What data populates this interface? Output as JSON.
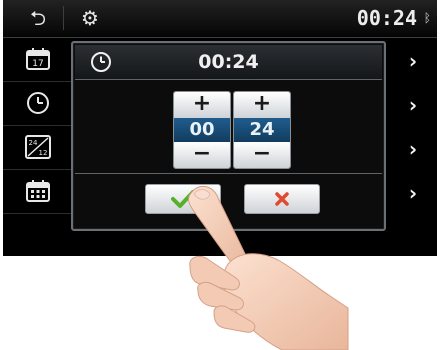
{
  "topbar": {
    "back_icon": "back-arrow-icon",
    "settings_icon": "gear-icon",
    "clock_text": "00:24",
    "bluetooth_icon": "bluetooth-icon"
  },
  "sidebar": {
    "items": [
      {
        "icon": "calendar-date-icon",
        "label": "17"
      },
      {
        "icon": "clock-icon"
      },
      {
        "icon": "time-format-24-12-icon",
        "label": "24/12"
      },
      {
        "icon": "calendar-icon"
      }
    ]
  },
  "dialog": {
    "header_icon": "clock-icon",
    "header_time": "00:24",
    "hours": {
      "value": "00",
      "plus": "+",
      "minus": "−"
    },
    "minutes": {
      "value": "24",
      "plus": "+",
      "minus": "−"
    },
    "ok_icon": "checkmark-icon",
    "cancel_icon": "x-icon"
  },
  "colors": {
    "ok_check": "#56b02a",
    "cancel_x": "#e24a2f",
    "value_bg": "#1a4e77"
  }
}
